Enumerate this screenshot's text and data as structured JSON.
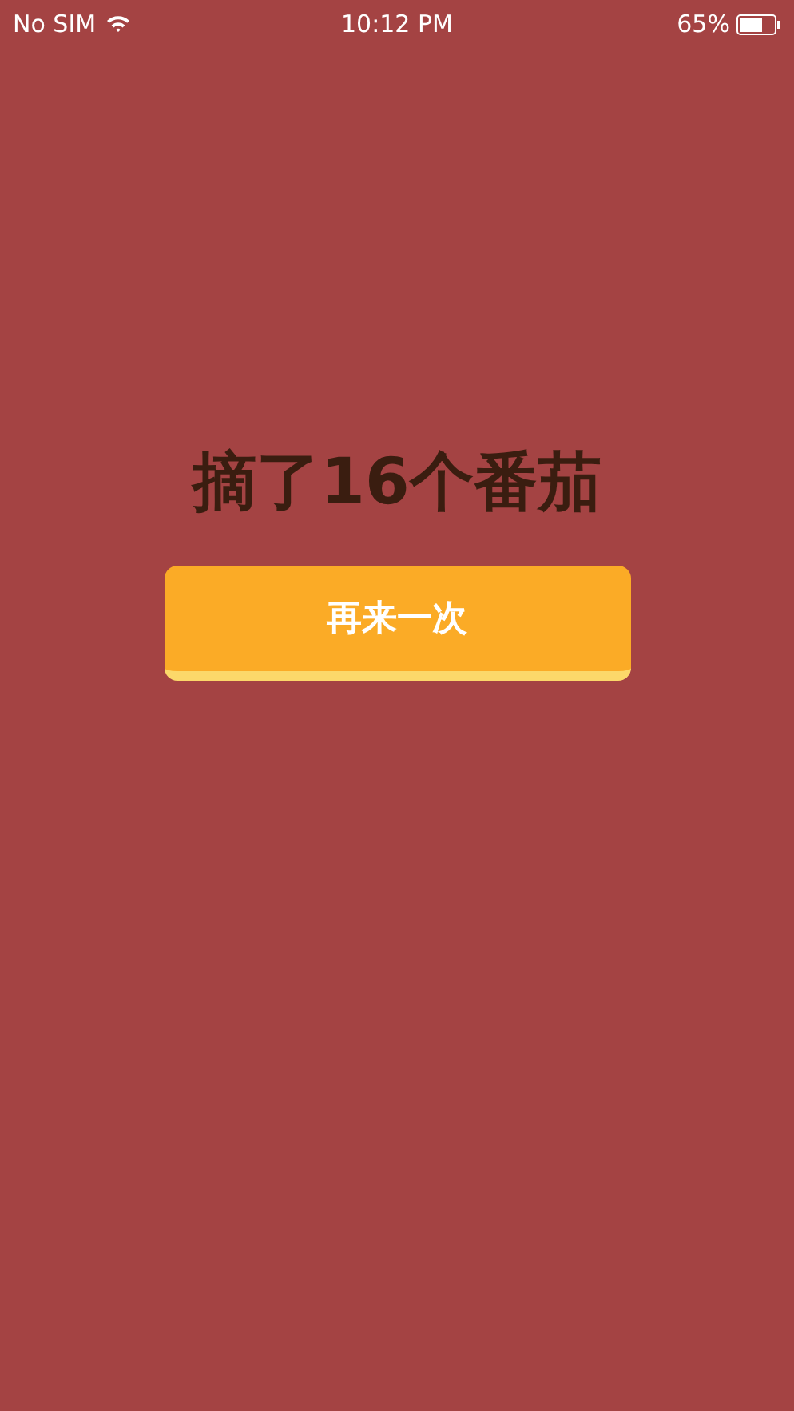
{
  "status_bar": {
    "carrier": "No SIM",
    "time": "10:12 PM",
    "battery": "65%"
  },
  "result": {
    "title": "摘了16个番茄"
  },
  "buttons": [
    {
      "label": "再来一次"
    }
  ]
}
